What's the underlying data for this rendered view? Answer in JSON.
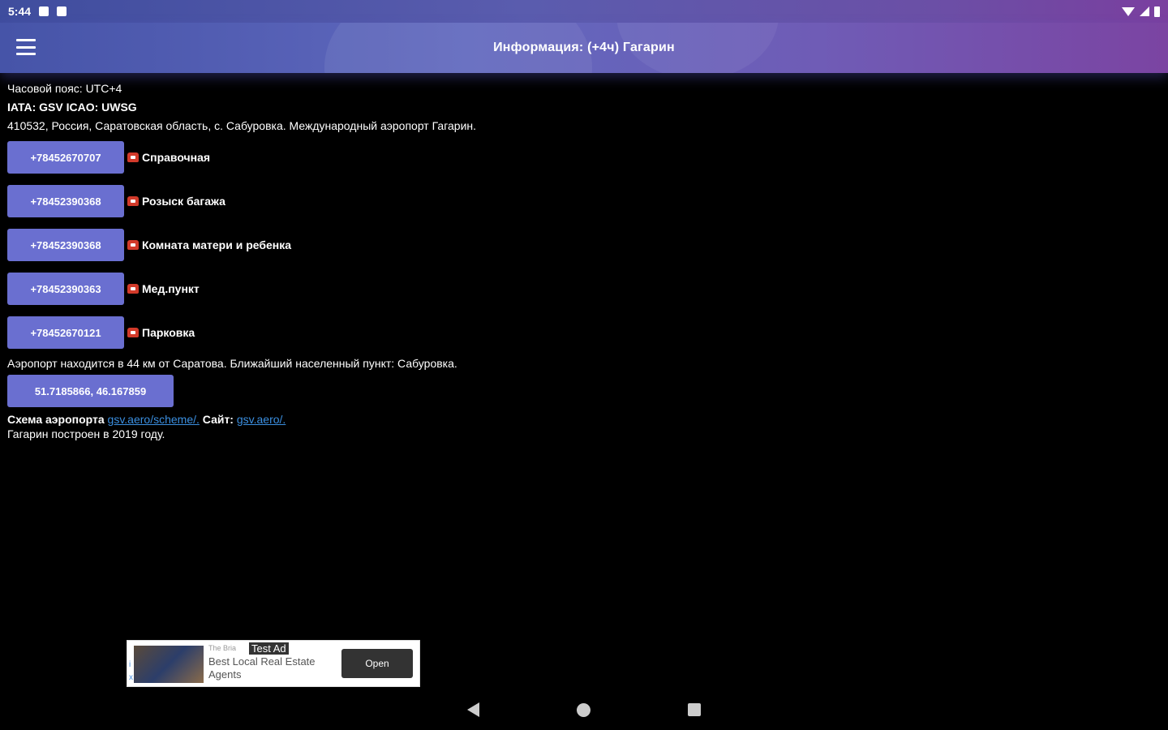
{
  "status_bar": {
    "time": "5:44"
  },
  "app_bar": {
    "title": "Информация: (+4ч) Гагарин"
  },
  "info": {
    "timezone": "Часовой пояс: UTC+4",
    "codes_prefix": "IATA: GSV ICAO: UWSG",
    "address": "410532, Россия, Саратовская область, с. Сабуровка. Международный аэропорт Гагарин."
  },
  "phones": [
    {
      "number": "+78452670707",
      "label": "Справочная"
    },
    {
      "number": "+78452390368",
      "label": "Розыск багажа"
    },
    {
      "number": "+78452390368",
      "label": "Комната матери и ребенка"
    },
    {
      "number": "+78452390363",
      "label": "Мед.пункт"
    },
    {
      "number": "+78452670121",
      "label": "Парковка"
    }
  ],
  "location": {
    "distance_text": "Аэропорт находится в 44 км от Саратова. Ближайший населенный пункт: Сабуровка.",
    "coordinates": "51.7185866, 46.167859"
  },
  "links": {
    "scheme_prefix": "Схема аэропорта",
    "scheme_link": "gsv.aero/scheme/.",
    "site_prefix": "Сайт:",
    "site_link": "gsv.aero/."
  },
  "history": "Гагарин построен в 2019 году.",
  "ad": {
    "tag": "Test Ad",
    "small_text": "The Bria",
    "headline": "Best Local Real Estate Agents",
    "open_label": "Open",
    "info_icon": "i",
    "close_icon": "x"
  },
  "colors": {
    "button": "#6a6fd0",
    "link": "#3b8fe0",
    "phone_icon": "#d23a2a"
  }
}
